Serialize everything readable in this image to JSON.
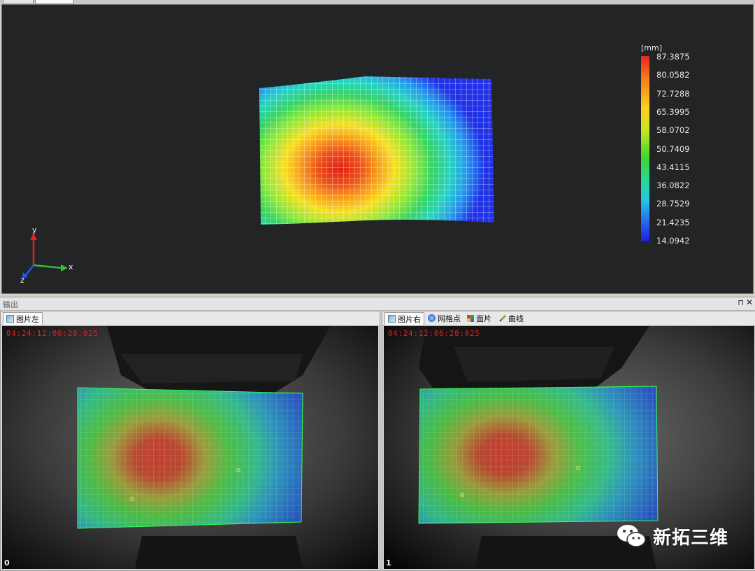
{
  "colors": {
    "viewport_bg": "#222425",
    "timestamp": "#e02424",
    "axis_x": "#2fbf3a",
    "axis_y": "#e02424",
    "axis_z": "#2456e6"
  },
  "viewer3d": {
    "axis_labels": {
      "x": "x",
      "y": "y",
      "z": "z"
    },
    "legend": {
      "unit": "[mm]",
      "ticks": [
        "87.3875",
        "80.0582",
        "72.7288",
        "65.3995",
        "58.0702",
        "50.7409",
        "43.4115",
        "36.0822",
        "28.7529",
        "21.4235",
        "14.0942"
      ]
    }
  },
  "output_pane": {
    "title": "输出",
    "pin_icon": "pin-icon",
    "close_icon": "close-icon",
    "left_panel": {
      "tabs": [
        {
          "label": "图片左",
          "icon": "image-icon"
        }
      ],
      "timestamp": "04:24:12:06:28:025",
      "index": "0"
    },
    "right_panel": {
      "tabs": [
        {
          "label": "图片右",
          "icon": "image-icon"
        },
        {
          "label": "网格点",
          "icon": "grid-points-icon"
        },
        {
          "label": "面片",
          "icon": "facet-icon"
        },
        {
          "label": "曲线",
          "icon": "curve-icon"
        }
      ],
      "timestamp": "04:24:12:06:28:025",
      "index": "1"
    }
  },
  "watermark": {
    "text": "新拓三维",
    "icon": "wechat-icon"
  }
}
